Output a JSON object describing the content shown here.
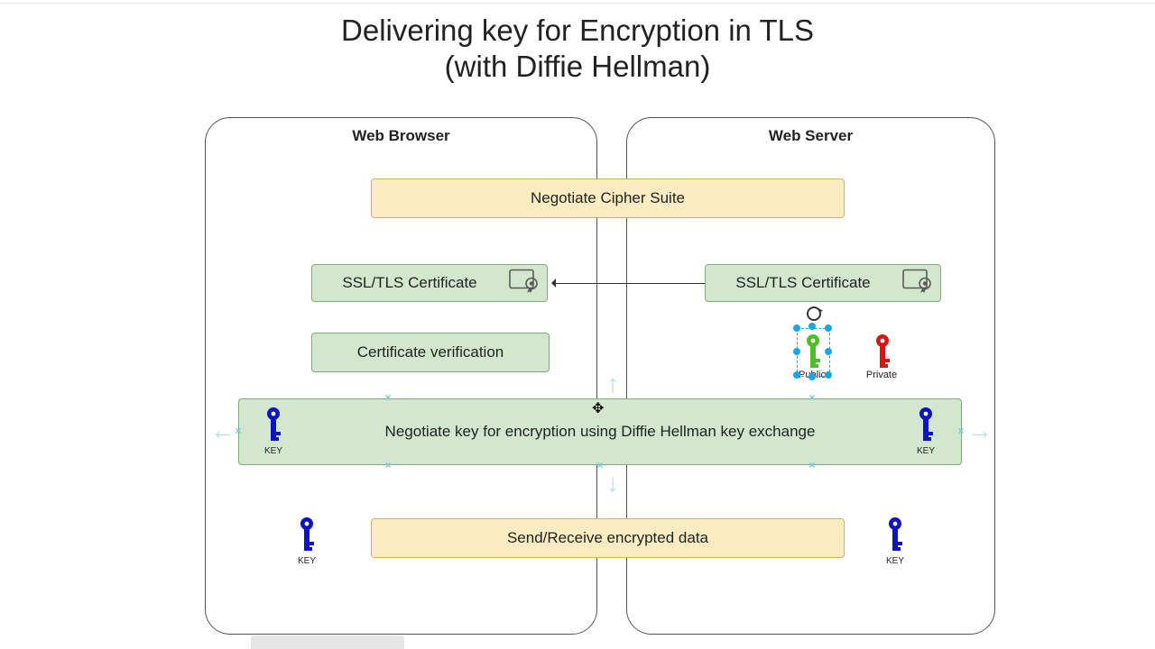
{
  "title_line1": "Delivering key for Encryption in TLS",
  "title_line2": "(with Diffie Hellman)",
  "actors": {
    "client": "Web Browser",
    "server": "Web Server"
  },
  "steps": {
    "cipher": "Negotiate Cipher Suite",
    "cert_client": "SSL/TLS Certificate",
    "cert_server": "SSL/TLS Certificate",
    "verify": "Certificate verification",
    "dh": "Negotiate key for encryption using Diffie Hellman key exchange",
    "data": "Send/Receive encrypted data"
  },
  "key_labels": {
    "public": "Public",
    "private": "Private",
    "key": "KEY"
  },
  "colors": {
    "yellow_fill": "#fbecc2",
    "yellow_border": "#d3b15c",
    "green_fill": "#d2e7ce",
    "green_border": "#7cae75",
    "key_blue": "#0b13c4",
    "key_green": "#4cbf22",
    "key_red": "#d81515",
    "sel_cyan": "#1aa6e6",
    "dir_arrow": "#b7e0ed"
  },
  "editor_state": {
    "selected_elements": [
      "public-key-icon",
      "dh-step"
    ]
  }
}
